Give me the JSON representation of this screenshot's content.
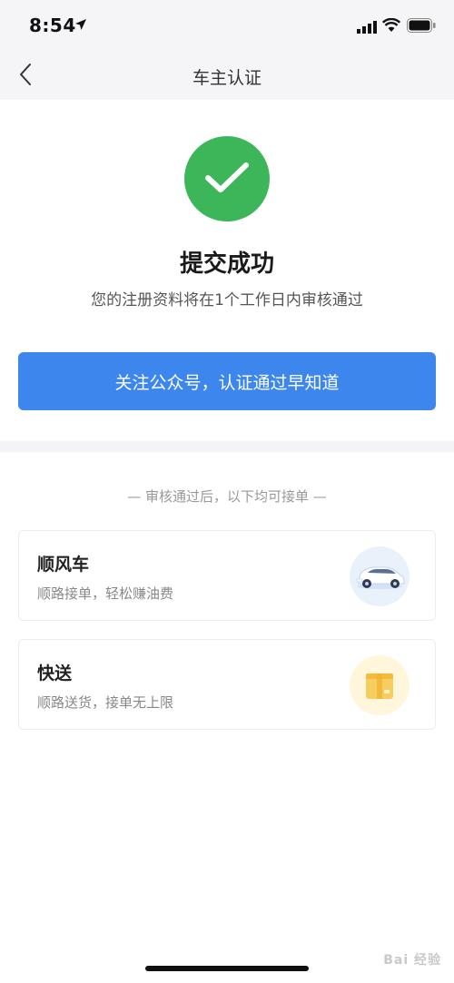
{
  "status_bar": {
    "time": "8:54"
  },
  "nav": {
    "title": "车主认证"
  },
  "success": {
    "title": "提交成功",
    "subtitle": "您的注册资料将在1个工作日内审核通过",
    "follow_button_label": "关注公众号，认证通过早知道"
  },
  "services": {
    "header": "— 审核通过后，以下均可接单 —",
    "items": [
      {
        "name": "顺风车",
        "description": "顺路接单，轻松赚油费",
        "icon": "car-icon"
      },
      {
        "name": "快送",
        "description": "顺路送货，接单无上限",
        "icon": "package-icon"
      }
    ]
  },
  "watermark": "Bai 经验",
  "colors": {
    "accent": "#3c86ee",
    "success": "#3db65a",
    "box": "#f7cd5f"
  }
}
